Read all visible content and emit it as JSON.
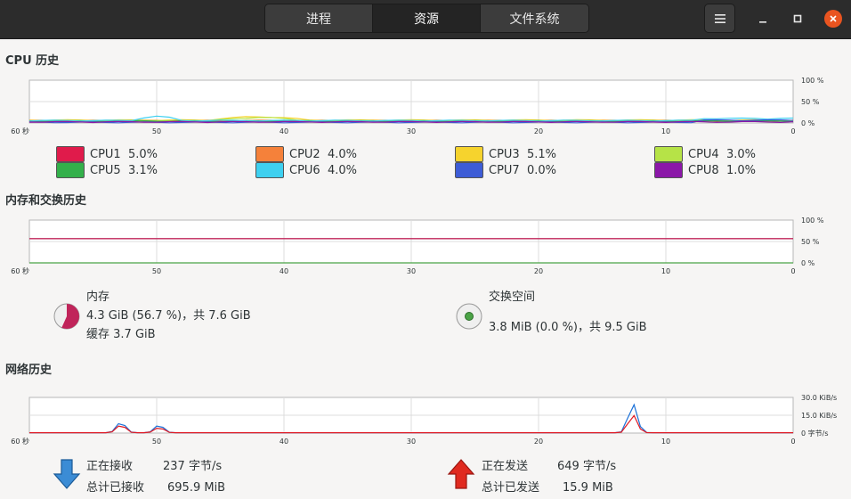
{
  "tabs": [
    {
      "label": "进程",
      "active": false
    },
    {
      "label": "资源",
      "active": true
    },
    {
      "label": "文件系统",
      "active": false
    }
  ],
  "window_controls": {
    "menu": "hamburger-icon",
    "minimize": "minimize-icon",
    "maximize": "maximize-icon",
    "close": "close-icon"
  },
  "cpu": {
    "title": "CPU 历史",
    "y_ticks": [
      "100 %",
      "50 %",
      "0 %"
    ],
    "x_ticks": [
      "60 秒",
      "50",
      "40",
      "30",
      "20",
      "10",
      "0"
    ],
    "legend": [
      {
        "label": "CPU1",
        "value": "5.0%",
        "color": "#e01b4b"
      },
      {
        "label": "CPU2",
        "value": "4.0%",
        "color": "#f5813a"
      },
      {
        "label": "CPU3",
        "value": "5.1%",
        "color": "#f6d32d"
      },
      {
        "label": "CPU4",
        "value": "3.0%",
        "color": "#b6e347"
      },
      {
        "label": "CPU5",
        "value": "3.1%",
        "color": "#33b04a"
      },
      {
        "label": "CPU6",
        "value": "4.0%",
        "color": "#3ed0f0"
      },
      {
        "label": "CPU7",
        "value": "0.0%",
        "color": "#3d5cd6"
      },
      {
        "label": "CPU8",
        "value": "1.0%",
        "color": "#8b17a8"
      }
    ]
  },
  "memory": {
    "title": "内存和交换历史",
    "y_ticks": [
      "100 %",
      "50 %",
      "0 %"
    ],
    "x_ticks": [
      "60 秒",
      "50",
      "40",
      "30",
      "20",
      "10",
      "0"
    ],
    "mem_label": "内存",
    "mem_value": "4.3 GiB (56.7 %)，共 7.6 GiB",
    "mem_cache": "缓存 3.7 GiB",
    "mem_fraction": 0.567,
    "mem_color": "#c0245a",
    "swap_label": "交换空间",
    "swap_value": "3.8 MiB (0.0 %)，共 9.5 GiB",
    "swap_color": "#4aa346"
  },
  "network": {
    "title": "网络历史",
    "y_ticks": [
      "30.0 KiB/s",
      "15.0 KiB/s",
      "0 字节/s"
    ],
    "x_ticks": [
      "60 秒",
      "50",
      "40",
      "30",
      "20",
      "10",
      "0"
    ],
    "recv_label": "正在接收",
    "recv_rate": "237 字节/s",
    "recv_total_label": "总计已接收",
    "recv_total": "695.9 MiB",
    "send_label": "正在发送",
    "send_rate": "649 字节/s",
    "send_total_label": "总计已发送",
    "send_total": "15.9 MiB",
    "recv_color": "#1c71d8",
    "send_color": "#e01b24"
  }
}
